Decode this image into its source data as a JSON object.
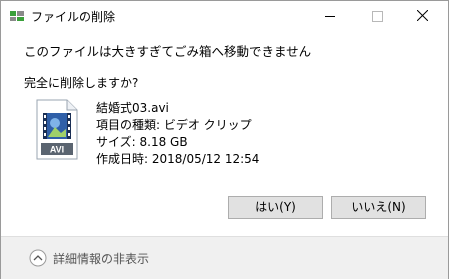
{
  "window": {
    "title": "ファイルの削除",
    "controls": {
      "minimize": "minimize",
      "maximize": "maximize",
      "close": "close"
    }
  },
  "message": {
    "headline": "このファイルは大きすぎてごみ箱へ移動できません",
    "question": "完全に削除しますか?"
  },
  "file": {
    "name": "結婚式03.avi",
    "type_line": "項目の種類: ビデオ クリップ",
    "size_line": "サイズ: 8.18 GB",
    "date_line": "作成日時: 2018/05/12 12:54",
    "icon_label": "AVI"
  },
  "buttons": {
    "yes": "はい(Y)",
    "no": "いいえ(N)"
  },
  "footer": {
    "toggle_label": "詳細情報の非表示"
  },
  "colors": {
    "title_icon_green": "#3aa03a",
    "title_icon_gray": "#8a8a8a",
    "file_icon_blue": "#2f5fa8",
    "button_bg": "#e1e1e1",
    "footer_bg": "#f0f0f0"
  },
  "icons": {
    "title": "recycle-delete-icon",
    "file": "avi-video-file-icon",
    "toggle": "chevron-up-circle-icon"
  }
}
